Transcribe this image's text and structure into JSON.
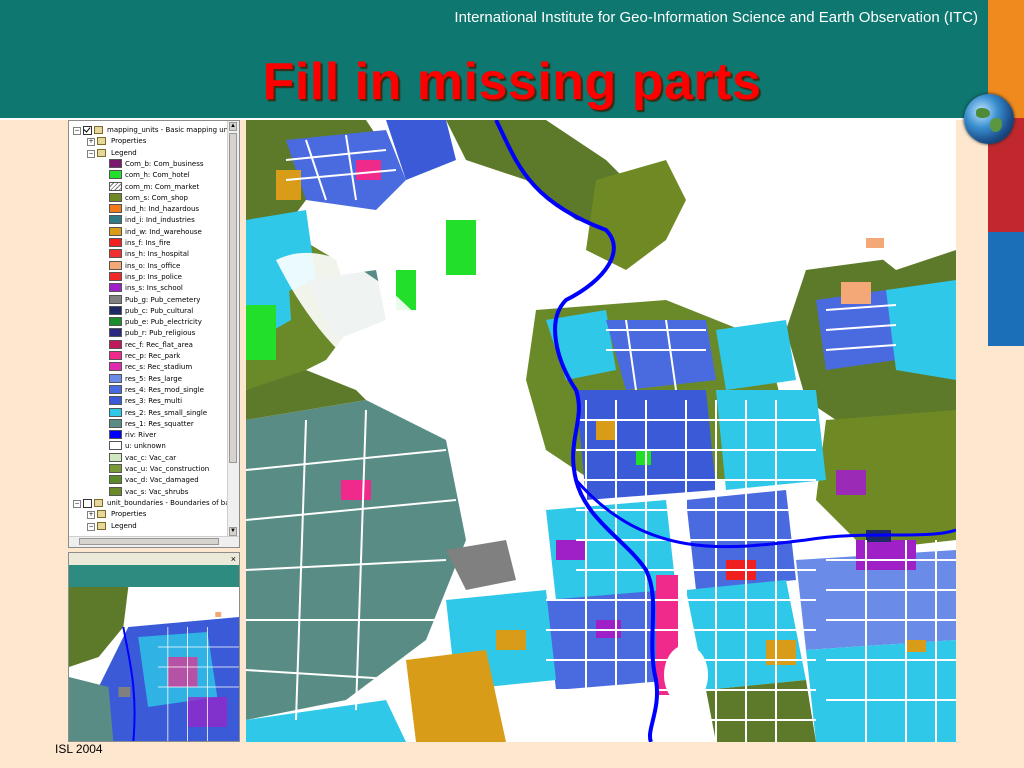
{
  "header": {
    "institute": "International Institute for Geo-Information Science and Earth Observation (ITC)",
    "title": "Fill in missing parts"
  },
  "footer": {
    "text": "ISL 2004"
  },
  "colors": {
    "header_bg": "#0d7770",
    "title": "#ff0000",
    "page_bg": "#fde8cf",
    "stripe_orange": "#f08a1e",
    "stripe_red": "#c0282e",
    "stripe_blue": "#1a6fb8",
    "river": "#0000ff",
    "vegetation": "#5d7a2a"
  },
  "icons": {
    "globe": "globe-icon",
    "expand": "plus-box-icon",
    "collapse": "minus-box-icon",
    "layer": "layer-icon",
    "legend": "legend-icon"
  },
  "tree": {
    "layer1": {
      "name": "mapping_units - Basic mapping unit",
      "checked": true
    },
    "layer1_properties": "Properties",
    "layer1_legend": "Legend",
    "layer2": {
      "name": "unit_boundaries - Boundaries of ba",
      "checked": false
    },
    "layer2_properties": "Properties",
    "layer2_legend": "Legend"
  },
  "legend": [
    {
      "label": "Com_b: Com_business",
      "color": "#7a1a6e"
    },
    {
      "label": "com_h: Com_hotel",
      "color": "#22e02a"
    },
    {
      "label": "com_m: Com_market",
      "color": "hatch"
    },
    {
      "label": "com_s: Com_shop",
      "color": "#6f8a24"
    },
    {
      "label": "ind_h: Ind_hazardous",
      "color": "#f07a1a"
    },
    {
      "label": "ind_i: Ind_industries",
      "color": "#2f7a86"
    },
    {
      "label": "ind_w: Ind_warehouse",
      "color": "#d89c18"
    },
    {
      "label": "ins_f: Ins_fire",
      "color": "#f02020"
    },
    {
      "label": "ins_h: Ins_hospital",
      "color": "#f03030"
    },
    {
      "label": "ins_o: Ins_office",
      "color": "#f4a878"
    },
    {
      "label": "ins_p: Ins_police",
      "color": "#f02828"
    },
    {
      "label": "ins_s: Ins_school",
      "color": "#a020c8"
    },
    {
      "label": "Pub_g: Pub_cemetery",
      "color": "#808080"
    },
    {
      "label": "pub_c: Pub_cultural",
      "color": "#1e2a66"
    },
    {
      "label": "pub_e: Pub_electricity",
      "color": "#1a8c2a"
    },
    {
      "label": "pub_r: Pub_religious",
      "color": "#2a2a80"
    },
    {
      "label": "rec_f: Rec_flat_area",
      "color": "#c01a5a"
    },
    {
      "label": "rec_p: Rec_park",
      "color": "#f02a8a"
    },
    {
      "label": "rec_s: Rec_stadium",
      "color": "#e02ab0"
    },
    {
      "label": "res_5: Res_large",
      "color": "#6a8ce8"
    },
    {
      "label": "res_4: Res_mod_single",
      "color": "#4a6ae0"
    },
    {
      "label": "res_3: Res_multi",
      "color": "#3a5ad8"
    },
    {
      "label": "res_2: Res_small_single",
      "color": "#30c8e8"
    },
    {
      "label": "res_1: Res_squatter",
      "color": "#5a8c86"
    },
    {
      "label": "riv: River",
      "color": "#0000ff"
    },
    {
      "label": "u: unknown",
      "color": "#ffffff"
    },
    {
      "label": "vac_c: Vac_car",
      "color": "#cfe8c0"
    },
    {
      "label": "vac_u: Vac_construction",
      "color": "#7a9a3a"
    },
    {
      "label": "vac_d: Vac_damaged",
      "color": "#5a8a2a"
    },
    {
      "label": "vac_s: Vac_shrubs",
      "color": "#6a8a2a"
    }
  ],
  "overview": {
    "close": "×"
  },
  "legend_close": "×"
}
